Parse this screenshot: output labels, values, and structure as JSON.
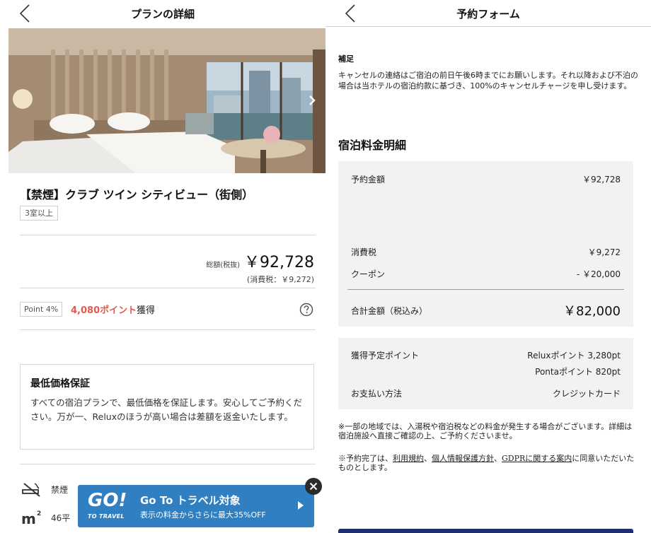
{
  "left": {
    "nav_title": "プランの詳細",
    "room_name": "【禁煙】クラブ ツイン シティビュー（街側）",
    "room_tag": "3室以上",
    "price_label": "総額(税抜)",
    "price_value": "￥92,728",
    "tax_note": "(消費税：￥9,272)",
    "point_badge": "Point 4%",
    "point_amount": "4,080ポイント",
    "point_suffix": "獲得",
    "guarantee_title": "最低価格保証",
    "guarantee_text": "すべての宿泊プランで、最低価格を保証します。安心してご予約ください。万が一、Reluxのほうが高い場合は差額を返金いたします。",
    "amenity_smoking": "禁煙",
    "amenity_size": "46平",
    "goto_logo": "GO!",
    "goto_sub": "TO TRAVEL",
    "goto_title": "Go To トラベル対象",
    "goto_desc": "表示の料金からさらに最大35%OFF"
  },
  "right": {
    "nav_title": "予約フォーム",
    "supplement_heading": "補足",
    "supplement_text": "キャンセルの連絡はご宿泊の前日午後6時までにお願いします。それ以降および不泊の場合は当ホテルの宿泊約款に基づき、100%のキャンセルチャージを申し受けます。",
    "section_title": "宿泊料金明細",
    "booking_label": "予約金額",
    "booking_value": "￥92,728",
    "tax_label": "消費税",
    "tax_value": "￥9,272",
    "coupon_label": "クーポン",
    "coupon_value": "- ￥20,000",
    "total_label": "合計金額（税込み）",
    "total_value": "￥82,000",
    "points_label": "獲得予定ポイント",
    "relux_points": "Reluxポイント 3,280pt",
    "ponta_points": "Pontaポイント 820pt",
    "payment_label": "お支払い方法",
    "payment_value": "クレジットカード",
    "note1": "※一部の地域では、入湯税や宿泊税などの料金が発生する場合がございます。詳細は宿泊施設へ直接ご確認の上、ご予約くださいませ。",
    "note2_prefix": "※予約完了は、",
    "link_terms": "利用規約",
    "sep1": "、",
    "link_privacy": "個人情報保護方針",
    "sep2": "、",
    "link_gdpr": "GDPRに関する案内",
    "note2_suffix": "に同意いただいたものとします。"
  },
  "colors": {
    "points_accent": "#e25a4b",
    "goto_blue": "#2f7fc1",
    "submit_navy": "#1f2e6e",
    "panel_gray": "#f2f2f2"
  },
  "icons": [
    "back-chevron-icon",
    "next-arrow-icon",
    "question-circle-icon",
    "no-smoking-icon",
    "square-meter-icon",
    "close-circle-icon",
    "chevron-right-icon"
  ]
}
